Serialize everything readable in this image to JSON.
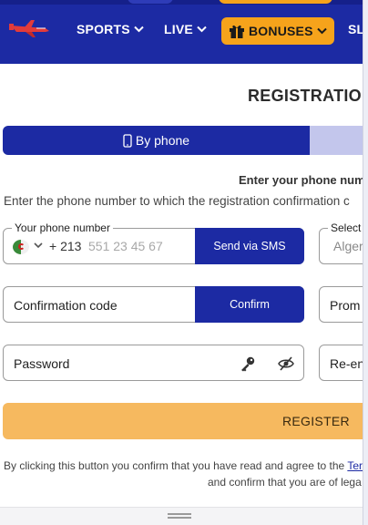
{
  "header": {
    "nav": {
      "sports": "SPORTS",
      "live": "LIVE",
      "bonuses": "BONUSES",
      "sl": "SL"
    },
    "brand_color": "#1c2aa3",
    "accent_color": "#f6a31b"
  },
  "main": {
    "title": "REGISTRATIO",
    "tabs": {
      "phone": "By phone"
    },
    "instruction_bold": "Enter your phone num",
    "instruction": "Enter the phone number to which the registration confirmation c",
    "phone_field": {
      "legend": "Your phone number",
      "dial_code": "+ 213",
      "placeholder": "551 23 45 67",
      "button": "Send via SMS"
    },
    "select_field": {
      "legend": "Select",
      "value": "Alger"
    },
    "confirmation_field": {
      "label": "Confirmation code",
      "button": "Confirm"
    },
    "promo_field": {
      "label": "Prom"
    },
    "password_field": {
      "label": "Password"
    },
    "repassword_field": {
      "label": "Re-en"
    },
    "register_button": "REGISTER",
    "terms_line1": "By clicking this button you confirm that you have read and agree to the ",
    "terms_link": "Ter",
    "terms_line2": "and confirm that you are of lega"
  }
}
